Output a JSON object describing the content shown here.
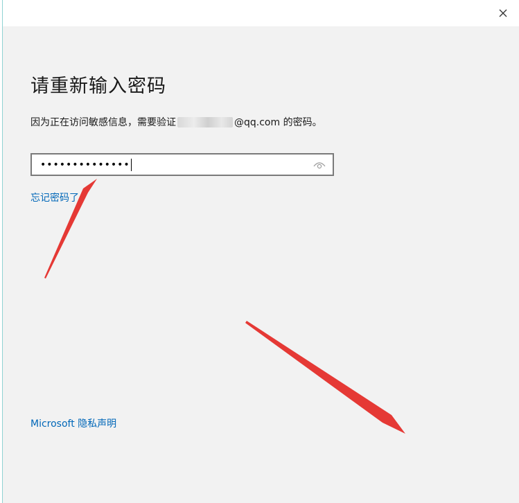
{
  "window": {
    "close_glyph": "✕"
  },
  "main": {
    "title": "请重新输入密码",
    "description_prefix": "因为正在访问敏感信息，需要验证",
    "description_suffix": "@qq.com 的密码。",
    "password": {
      "masked_value": "••••••••••••••",
      "toggle_icon": "eye-icon"
    },
    "forgot_link": "忘记密码了",
    "privacy_link": "Microsoft 隐私声明"
  },
  "colors": {
    "link": "#0067b8",
    "background": "#f2f2f2",
    "annotation_arrow": "#e53935"
  }
}
